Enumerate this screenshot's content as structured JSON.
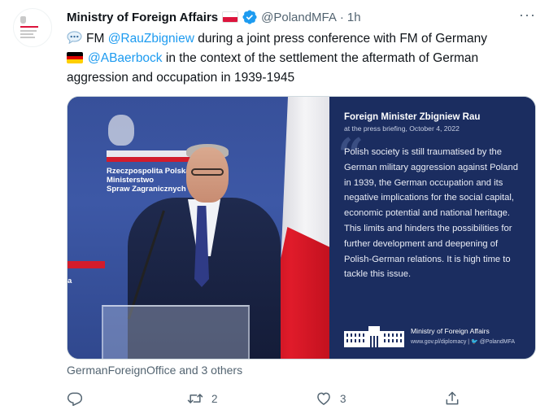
{
  "tweet": {
    "display_name": "Ministry of Foreign Affairs",
    "handle": "@PolandMFA",
    "separator": "·",
    "time": "1h",
    "more_glyph": "···",
    "avatar": {
      "tiny_text": "Ministry of Foreign Affairs Republic of Poland"
    },
    "text": {
      "part1": "FM ",
      "mention1": "@RauZbigniew",
      "part2": " during a joint press conference with FM of Germany",
      "mention2": "@ABaerbock",
      "part3": " in the context of the settlement the aftermath of German aggression and occupation in 1939-1945"
    },
    "icons": {
      "speech": "speech-balloon-icon",
      "flag_pl": "poland-flag-icon",
      "flag_de": "germany-flag-icon",
      "verified": "verified-badge-icon"
    },
    "colors": {
      "accent": "#1d9bf0",
      "text": "#0f1419",
      "secondary": "#536471",
      "panel_bg": "#1b2d60",
      "flag_red": "#dc143c"
    }
  },
  "media": {
    "photo": {
      "sign_line1": "Rzeczpospolita Polska",
      "sign_line2": "Ministerstwo",
      "sign_line3": "Spraw Zagranicznych",
      "left_fragment": "a"
    },
    "panel": {
      "title": "Foreign Minister Zbigniew Rau",
      "subtitle": "at the press briefing, October 4, 2022",
      "quote_mark": "“",
      "quote": "Polish society is still traumatised by the German military aggression against Poland in 1939, the German occupation and its negative implications for the social capital, economic potential and national heritage. This limits and hinders the possibilities for further development and deepening of Polish-German relations. It is high time to tackle this issue.",
      "footer_org": "Ministry of Foreign Affairs",
      "footer_links": "www.gov.pl/diplomacy | 🐦 @PolandMFA"
    }
  },
  "tags": {
    "text": "GermanForeignOffice and 3 others"
  },
  "actions": {
    "reply": {
      "icon": "reply-icon",
      "count": ""
    },
    "retweet": {
      "icon": "retweet-icon",
      "count": "2"
    },
    "like": {
      "icon": "heart-icon",
      "count": "3"
    },
    "share": {
      "icon": "share-icon",
      "count": ""
    }
  }
}
